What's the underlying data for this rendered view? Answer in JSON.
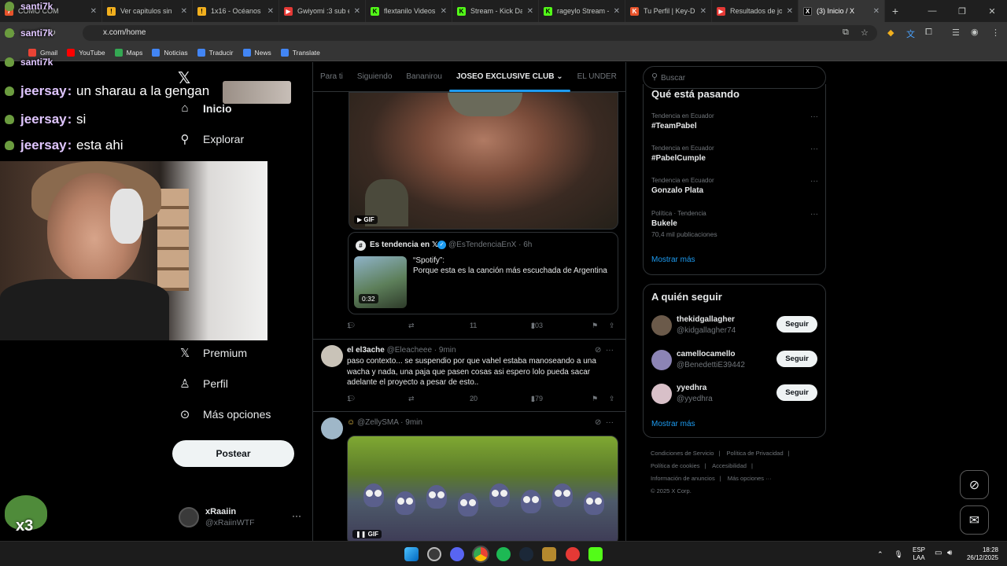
{
  "browser": {
    "tabs": [
      {
        "label": "CÓMO COM",
        "favicon_color": "#e8532b",
        "favicon_text": "7"
      },
      {
        "label": "Ver capitulos sin",
        "favicon_color": "#f2b01e",
        "favicon_text": "⚠"
      },
      {
        "label": "1x16 - Océanos d",
        "favicon_color": "#f2b01e",
        "favicon_text": "⚠"
      },
      {
        "label": "Gwiyomi :3 sub e",
        "favicon_color": "#e53935",
        "favicon_text": "▶"
      },
      {
        "label": "flextanilo Videos",
        "favicon_color": "#53fc18",
        "favicon_text": "K"
      },
      {
        "label": "Stream - Kick Das",
        "favicon_color": "#53fc18",
        "favicon_text": "K"
      },
      {
        "label": "rageylo Stream - ",
        "favicon_color": "#53fc18",
        "favicon_text": "K"
      },
      {
        "label": "Tu Perfil | Key-Dr",
        "favicon_color": "#e8532b",
        "favicon_text": "K"
      },
      {
        "label": "Resultados de jos",
        "favicon_color": "#e53935",
        "favicon_text": "▶"
      },
      {
        "label": "(3) Inicio / X",
        "favicon_color": "#000000",
        "favicon_text": "X",
        "active": true
      }
    ],
    "url": "x.com/home",
    "bookmarks": [
      {
        "label": "Gmail",
        "color": "#ea4335"
      },
      {
        "label": "YouTube",
        "color": "#ff0000"
      },
      {
        "label": "Maps",
        "color": "#34a853"
      },
      {
        "label": "Noticias",
        "color": "#4285f4"
      },
      {
        "label": "Traducir",
        "color": "#4285f4"
      },
      {
        "label": "News",
        "color": "#4285f4"
      },
      {
        "label": "Translate",
        "color": "#4285f4"
      }
    ]
  },
  "x": {
    "nav": [
      {
        "label": "Inicio",
        "icon": "home-icon",
        "glyph": "⌂"
      },
      {
        "label": "Explorar",
        "icon": "search-icon",
        "glyph": "⚲"
      },
      {
        "label": "Premium",
        "icon": "x-premium-icon",
        "glyph": "𝕏"
      },
      {
        "label": "Perfil",
        "icon": "person-icon",
        "glyph": "👤"
      },
      {
        "label": "Más opciones",
        "icon": "more-circle-icon",
        "glyph": "⋯"
      }
    ],
    "post_button": "Postear",
    "account": {
      "name": "xRaaiin",
      "handle": "@xRaiinWTF"
    },
    "tabs": [
      "Para ti",
      "Siguiendo",
      "Bananirou",
      "JOSEO EXCLUSIVE CLUB ⌄",
      "EL UNDER"
    ],
    "active_tab": 3,
    "post1": {
      "gif_label": "GIF",
      "quote": {
        "name": "Es tendencia en 𝕏",
        "handle": "@EsTendenciaEnX · 6h",
        "duration": "0:32",
        "title": "“Spotify”:",
        "desc": "Porque esta es la canción más escuchada de Argentina"
      },
      "replies": "1",
      "likes": "11",
      "views": "203"
    },
    "post2": {
      "name": "el el3ache",
      "handle": "@Eleacheee · 9min",
      "text": "paso contexto... se suspendio por que vahel estaba manoseando a una wacha y nada, una paja que pasen cosas asi espero lolo pueda sacar adelante el proyecto a pesar de esto..",
      "replies": "1",
      "likes": "20",
      "views": "179"
    },
    "post3": {
      "handle": "@ZellySMA · 9min",
      "gif_label": "GIF"
    },
    "search_placeholder": "Buscar",
    "trends_title": "Qué está pasando",
    "trends": [
      {
        "context": "Tendencia en Ecuador",
        "name": "#TeamPabel",
        "count": ""
      },
      {
        "context": "Tendencia en Ecuador",
        "name": "#PabelCumple",
        "count": ""
      },
      {
        "context": "Tendencia en Ecuador",
        "name": "Gonzalo Plata",
        "count": ""
      },
      {
        "context": "Política · Tendencia",
        "name": "Bukele",
        "count": "70,4 mil publicaciones"
      }
    ],
    "show_more": "Mostrar más",
    "follow_title": "A quién seguir",
    "who_to_follow": [
      {
        "name": "thekidgallagher",
        "handle": "@kidgallagher74",
        "button": "Seguir",
        "color": "#6b5a4a"
      },
      {
        "name": "camellocamello",
        "handle": "@BenedettiE39442",
        "button": "Seguir",
        "color": "#8c84b5"
      },
      {
        "name": "yyedhra",
        "handle": "@yyedhra",
        "button": "Seguir",
        "color": "#d8c0c8"
      }
    ],
    "footer": [
      "Condiciones de Servicio",
      "|",
      "Política de Privacidad",
      "|",
      "Política de cookies",
      "|",
      "Accesibilidad",
      "|",
      "Información de anuncios",
      "|",
      "Más opciones ···",
      "© 2025 X Corp."
    ]
  },
  "stream": {
    "chat": [
      {
        "user": "santi7k",
        "msg": ""
      },
      {
        "user": "santi7k",
        "msg": ""
      },
      {
        "user": "santi7k",
        "msg": ""
      },
      {
        "user": "jeersay",
        "msg": "un sharau a la gengan"
      },
      {
        "user": "jeersay",
        "msg": "si"
      },
      {
        "user": "jeersay",
        "msg": "esta ahi"
      }
    ],
    "emote_multiplier": "x3"
  },
  "taskbar": {
    "lang": "ESP",
    "lang2": "LAA",
    "time": "18:28",
    "date": "26/12/2025"
  }
}
